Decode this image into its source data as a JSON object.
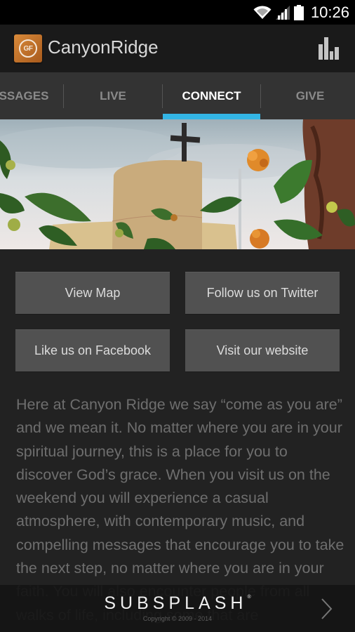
{
  "status_bar": {
    "time": "10:26",
    "icons": [
      "wifi-icon",
      "signal-icon",
      "battery-icon"
    ]
  },
  "action_bar": {
    "app_title": "CanyonRidge",
    "logo_text": "GF",
    "action_icon": "bar-chart-icon"
  },
  "tabs": {
    "items": [
      {
        "label": "SSAGES",
        "full_label": "MESSAGES",
        "active": false
      },
      {
        "label": "LIVE",
        "active": false
      },
      {
        "label": "CONNECT",
        "active": true
      },
      {
        "label": "GIVE",
        "active": false
      }
    ],
    "accent_color": "#33b5e5"
  },
  "hero": {
    "description": "Church building with cross, flowers and leaves in foreground"
  },
  "buttons": {
    "view_map": "View Map",
    "twitter": "Follow us on Twitter",
    "facebook": "Like us on Facebook",
    "website": "Visit our website"
  },
  "content": {
    "paragraph": "Here at Canyon Ridge we say “come as you are” and we mean it.  No matter where you are in your spiritual journey, this is a place for you to discover God’s grace.  When you visit us on the weekend you will experience a casual atmosphere, with contemporary music, and compelling messages that encourage you to take the next step, no matter where you are in your faith.  You will also encounter people from all walks of life, including some that are"
  },
  "footer": {
    "brand": "SUBSPLASH",
    "registered": "®",
    "copyright": "Copyright © 2009 - 2014"
  }
}
